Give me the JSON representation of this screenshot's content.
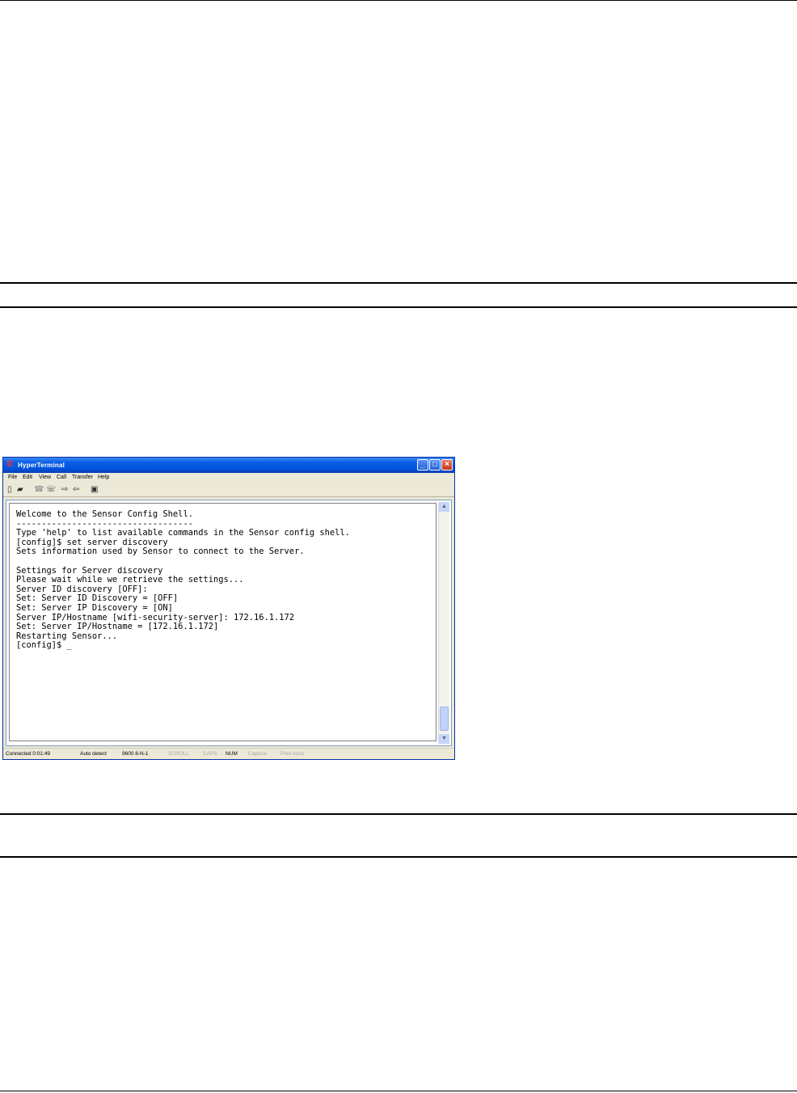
{
  "window": {
    "title": "HyperTerminal",
    "menu": [
      "File",
      "Edit",
      "View",
      "Call",
      "Transfer",
      "Help"
    ],
    "controls": {
      "minimize": "_",
      "maximize": "□",
      "close": "×"
    }
  },
  "terminal": {
    "lines": [
      "Welcome to the Sensor Config Shell.",
      "-----------------------------------",
      "Type 'help' to list available commands in the Sensor config shell.",
      "[config]$ set server discovery",
      "Sets information used by Sensor to connect to the Server.",
      "",
      "Settings for Server discovery",
      "Please wait while we retrieve the settings...",
      "Server ID discovery [OFF]:",
      "Set: Server ID Discovery = [OFF]",
      "Set: Server IP Discovery = [ON]",
      "Server IP/Hostname [wifi-security-server]: 172.16.1.172",
      "Set: Server IP/Hostname = [172.16.1.172]",
      "Restarting Sensor...",
      "[config]$ _"
    ]
  },
  "statusbar": {
    "connected": "Connected 0:01:49",
    "detect": "Auto detect",
    "port": "9600 8-N-1",
    "scroll": "SCROLL",
    "caps": "CAPS",
    "num": "NUM",
    "capture": "Capture",
    "print_echo": "Print echo"
  }
}
